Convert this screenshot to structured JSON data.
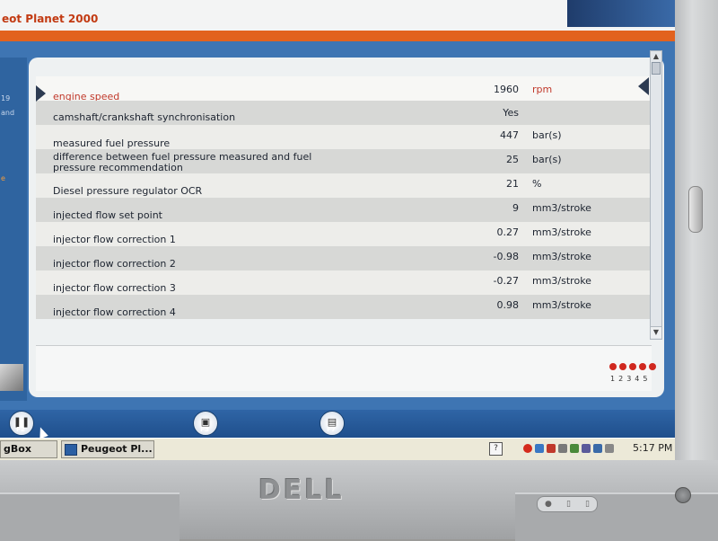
{
  "app": {
    "title": "eot Planet 2000"
  },
  "sidebar": {
    "fragments": [
      "19",
      "and",
      "e"
    ]
  },
  "parameters": [
    {
      "label": "engine speed",
      "value": "1960",
      "unit": "rpm",
      "selected": true
    },
    {
      "label": "camshaft/crankshaft synchronisation",
      "value": "Yes",
      "unit": ""
    },
    {
      "label": "measured fuel pressure",
      "value": "447",
      "unit": "bar(s)"
    },
    {
      "label": "difference between fuel pressure measured and fuel pressure recommendation",
      "value": "25",
      "unit": "bar(s)"
    },
    {
      "label": "Diesel pressure regulator OCR",
      "value": "21",
      "unit": "%"
    },
    {
      "label": "injected flow set point",
      "value": "9",
      "unit": "mm3/stroke"
    },
    {
      "label": "injector flow correction 1",
      "value": "0.27",
      "unit": "mm3/stroke"
    },
    {
      "label": "injector flow correction 2",
      "value": "-0.98",
      "unit": "mm3/stroke"
    },
    {
      "label": "injector flow correction 3",
      "value": "-0.27",
      "unit": "mm3/stroke"
    },
    {
      "label": "injector flow correction 4",
      "value": "0.98",
      "unit": "mm3/stroke"
    }
  ],
  "pages": [
    "1",
    "2",
    "3",
    "4",
    "5"
  ],
  "toolbar": {
    "pause_key": "F2",
    "save_key": "F3",
    "print_key": "F7"
  },
  "taskbar": {
    "item1": "gBox",
    "item2": "Peugeot Pl...",
    "help": "?",
    "clock": "5:17 PM"
  },
  "bezel": {
    "logo": "DELL"
  },
  "colors": {
    "accent_orange": "#e2621e",
    "frame_blue": "#3e75b3",
    "active_red": "#c0392b"
  }
}
